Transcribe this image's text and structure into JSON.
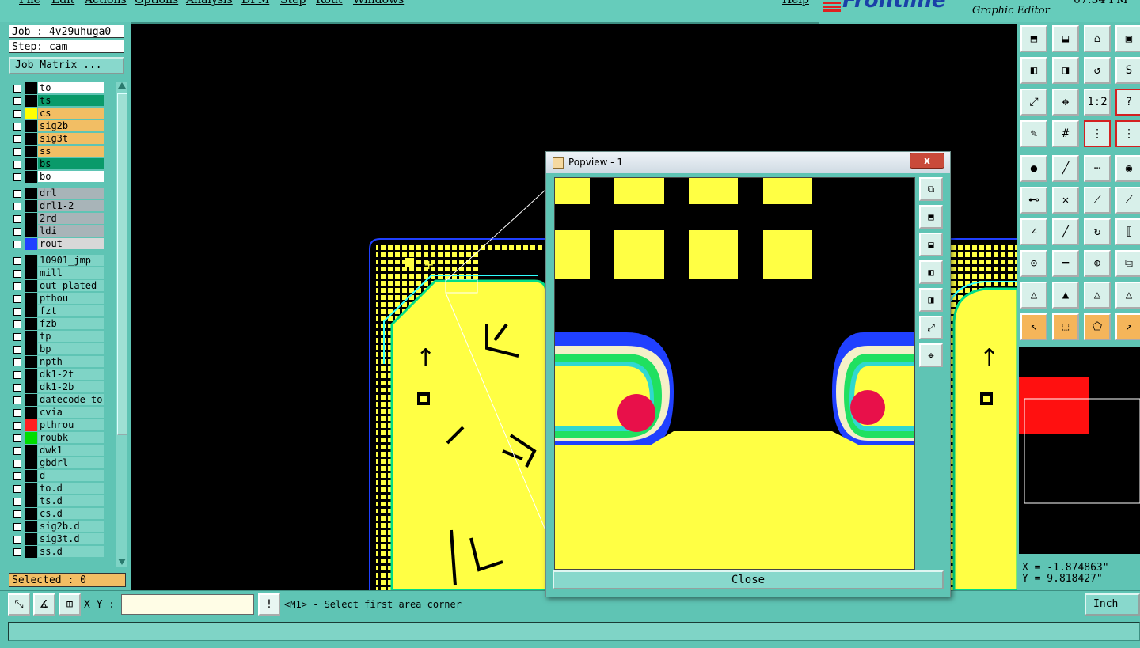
{
  "menu": {
    "items": [
      "File",
      "Edit",
      "Actions",
      "Options",
      "Analysis",
      "DFM",
      "Step",
      "Rout",
      "Windows"
    ],
    "help": "Help"
  },
  "brand": {
    "logo": "Frontline",
    "subtitle": "Graphic Editor",
    "time": "07:34 PM"
  },
  "job": {
    "label": "Job : 4v29uhuga0",
    "step": "Step: cam",
    "matrix_button": "Job Matrix ..."
  },
  "layers": [
    {
      "name": "to",
      "swatch": "#000000",
      "bg": "#ffffff"
    },
    {
      "name": "ts",
      "swatch": "#000000",
      "bg": "#0a9a6a"
    },
    {
      "name": "cs",
      "swatch": "#ffff00",
      "bg": "#f2be64"
    },
    {
      "name": "sig2b",
      "swatch": "#000000",
      "bg": "#f2be64"
    },
    {
      "name": "sig3t",
      "swatch": "#000000",
      "bg": "#f2be64"
    },
    {
      "name": "ss",
      "swatch": "#000000",
      "bg": "#f2be64"
    },
    {
      "name": "bs",
      "swatch": "#000000",
      "bg": "#0a9a6a"
    },
    {
      "name": "bo",
      "swatch": "#000000",
      "bg": "#ffffff"
    },
    {
      "name": "drl",
      "swatch": "#000000",
      "bg": "#a8b4b8"
    },
    {
      "name": "drl1-2",
      "swatch": "#000000",
      "bg": "#a8b4b8"
    },
    {
      "name": "2rd",
      "swatch": "#000000",
      "bg": "#a8b4b8"
    },
    {
      "name": "ldi",
      "swatch": "#000000",
      "bg": "#a8b4b8"
    },
    {
      "name": "rout",
      "swatch": "#2040ff",
      "bg": "#d8d8d8"
    },
    {
      "name": "10901_jmp",
      "swatch": "#000000",
      "bg": "#7fd4c6"
    },
    {
      "name": "mill",
      "swatch": "#000000",
      "bg": "#7fd4c6"
    },
    {
      "name": "out-plated",
      "swatch": "#000000",
      "bg": "#7fd4c6"
    },
    {
      "name": "pthou",
      "swatch": "#000000",
      "bg": "#7fd4c6"
    },
    {
      "name": "fzt",
      "swatch": "#000000",
      "bg": "#7fd4c6"
    },
    {
      "name": "fzb",
      "swatch": "#000000",
      "bg": "#7fd4c6"
    },
    {
      "name": "tp",
      "swatch": "#000000",
      "bg": "#7fd4c6"
    },
    {
      "name": "bp",
      "swatch": "#000000",
      "bg": "#7fd4c6"
    },
    {
      "name": "npth",
      "swatch": "#000000",
      "bg": "#7fd4c6"
    },
    {
      "name": "dk1-2t",
      "swatch": "#000000",
      "bg": "#7fd4c6"
    },
    {
      "name": "dk1-2b",
      "swatch": "#000000",
      "bg": "#7fd4c6"
    },
    {
      "name": "datecode-to",
      "swatch": "#000000",
      "bg": "#7fd4c6"
    },
    {
      "name": "cvia",
      "swatch": "#000000",
      "bg": "#7fd4c6"
    },
    {
      "name": "pthrou",
      "swatch": "#ff2020",
      "bg": "#7fd4c6"
    },
    {
      "name": "roubk",
      "swatch": "#00dd00",
      "bg": "#7fd4c6"
    },
    {
      "name": "dwk1",
      "swatch": "#000000",
      "bg": "#7fd4c6"
    },
    {
      "name": "gbdrl",
      "swatch": "#000000",
      "bg": "#7fd4c6"
    },
    {
      "name": "d",
      "swatch": "#000000",
      "bg": "#7fd4c6"
    },
    {
      "name": "to.d",
      "swatch": "#000000",
      "bg": "#7fd4c6"
    },
    {
      "name": "ts.d",
      "swatch": "#000000",
      "bg": "#7fd4c6"
    },
    {
      "name": "cs.d",
      "swatch": "#000000",
      "bg": "#7fd4c6"
    },
    {
      "name": "sig2b.d",
      "swatch": "#000000",
      "bg": "#7fd4c6"
    },
    {
      "name": "sig3t.d",
      "swatch": "#000000",
      "bg": "#7fd4c6"
    },
    {
      "name": "ss.d",
      "swatch": "#000000",
      "bg": "#7fd4c6"
    }
  ],
  "selected": "Selected : 0",
  "command": {
    "xy_label": "X Y :",
    "input_value": "",
    "prompt": "<M1> - Select first area corner",
    "units": "Inch"
  },
  "coords": {
    "x": "X = -1.874863\"",
    "y": "Y = 9.818427\""
  },
  "popview": {
    "title": "Popview - 1",
    "close_button": "Close"
  },
  "colors": {
    "panel": "#5fc4b4",
    "canvas": "#000000",
    "copper": "#ffff44",
    "outline": "#2040ff",
    "accent_red": "#e8104a"
  }
}
